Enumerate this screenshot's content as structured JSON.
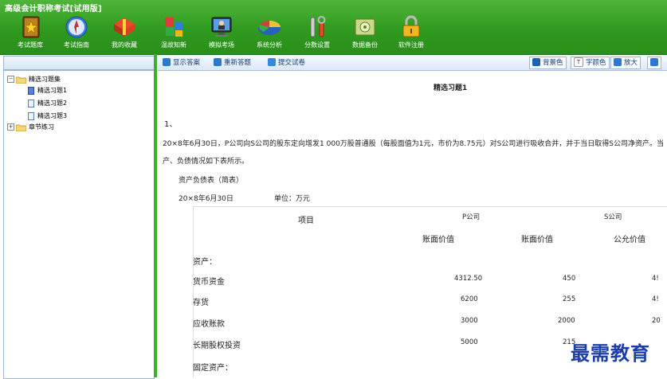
{
  "app": {
    "title": "高级会计职称考试[试用版]"
  },
  "toolbar": {
    "items": [
      {
        "label": "考试题库",
        "icon": "book-star-icon"
      },
      {
        "label": "考试指南",
        "icon": "compass-icon"
      },
      {
        "label": "我的收藏",
        "icon": "gift-icon"
      },
      {
        "label": "温故知新",
        "icon": "cubes-icon"
      },
      {
        "label": "模拟考场",
        "icon": "monitor-person-icon"
      },
      {
        "label": "系统分析",
        "icon": "pie-chart-icon"
      },
      {
        "label": "分数设置",
        "icon": "tools-icon"
      },
      {
        "label": "数据备份",
        "icon": "disk-icon"
      },
      {
        "label": "软件注册",
        "icon": "lock-icon"
      }
    ]
  },
  "tree": {
    "root": "精选习题集",
    "children": [
      "精选习题1",
      "精选习题2",
      "精选习题3"
    ],
    "second_root": "章节练习"
  },
  "content_toolbar": {
    "show_answer": "显示答案",
    "redo": "重新答题",
    "submit": "提交试卷",
    "bg_color": "背景色",
    "font_color": "字颜色",
    "zoom_in": "放大"
  },
  "question": {
    "title": "精选习题1",
    "number": "1、",
    "line1": "20×8年6月30日，P公司向S公司的股东定向增发1 000万股普通股（每股面值为1元，市价为8.75元）对S公司进行吸收合并，并于当日取得S公司净资产。当",
    "line2": "产、负债情况如下表所示。",
    "table_title": "资产负债表（简表）",
    "date": "20×8年6月30日",
    "unit": "单位：万元",
    "headers": {
      "item": "项目",
      "p_company": "P公司",
      "s_company": "S公司",
      "book1": "账面价值",
      "book2": "账面价值",
      "fair": "公允价值"
    },
    "rows": [
      {
        "label": "资产：",
        "p": "",
        "s_book": "",
        "s_fair": ""
      },
      {
        "label": "货币资金",
        "p": "4312.50",
        "s_book": "450",
        "s_fair": "4!"
      },
      {
        "label": "存货",
        "p": "6200",
        "s_book": "255",
        "s_fair": "4!"
      },
      {
        "label": "应收账款",
        "p": "3000",
        "s_book": "2000",
        "s_fair": "20"
      },
      {
        "label": "长期股权投资",
        "p": "5000",
        "s_book": "215",
        "s_fair": ""
      },
      {
        "label": "固定资产：",
        "p": "",
        "s_book": "",
        "s_fair": ""
      }
    ]
  },
  "watermark": "最需教育"
}
